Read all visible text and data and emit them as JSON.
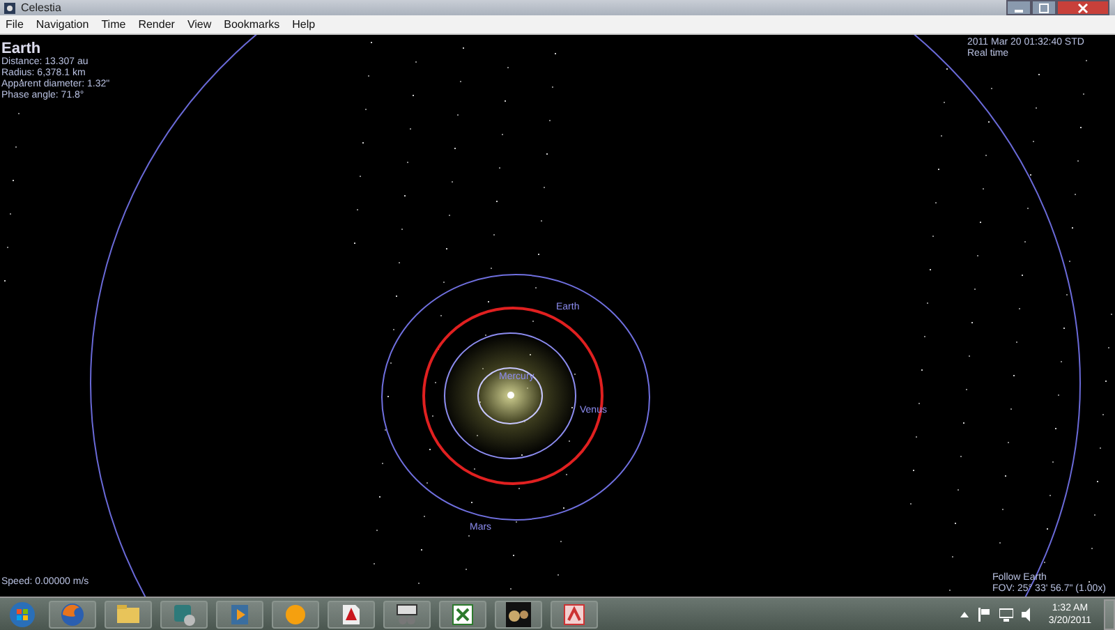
{
  "window": {
    "title": "Celestia"
  },
  "menu": [
    "File",
    "Navigation",
    "Time",
    "Render",
    "View",
    "Bookmarks",
    "Help"
  ],
  "info": {
    "title": "Earth",
    "lines": [
      "Distance: 13.307 au",
      "Radius: 6,378.1 km",
      "Apparent diameter: 1.32\"",
      "Phase angle: 71.8°"
    ]
  },
  "time": {
    "lines": [
      "2011 Mar 20 01:32:40 STD",
      "Real time"
    ]
  },
  "orbits": [
    {
      "label": "Mercury",
      "color": "#c8c8ff"
    },
    {
      "label": "Venus",
      "color": "#8c8cf0"
    },
    {
      "label": "Earth",
      "color": "#e02020"
    },
    {
      "label": "Mars",
      "color": "#7070e0"
    },
    {
      "color": "#6a6ad8"
    }
  ],
  "speed": "Speed: 0.00000 m/s",
  "follow": {
    "lines": [
      "Follow Earth",
      "FOV: 25° 33' 56.7\" (1.00x)"
    ]
  },
  "taskbar": {
    "apps": [
      {
        "kind": "browser"
      },
      {
        "kind": "folder"
      },
      {
        "kind": "tool"
      },
      {
        "kind": "media"
      },
      {
        "kind": "sun"
      },
      {
        "kind": "pdf"
      },
      {
        "kind": "device"
      },
      {
        "kind": "sheet"
      },
      {
        "kind": "planets"
      },
      {
        "kind": "doc"
      }
    ],
    "time": "1:32 AM",
    "date": "3/20/2011"
  }
}
